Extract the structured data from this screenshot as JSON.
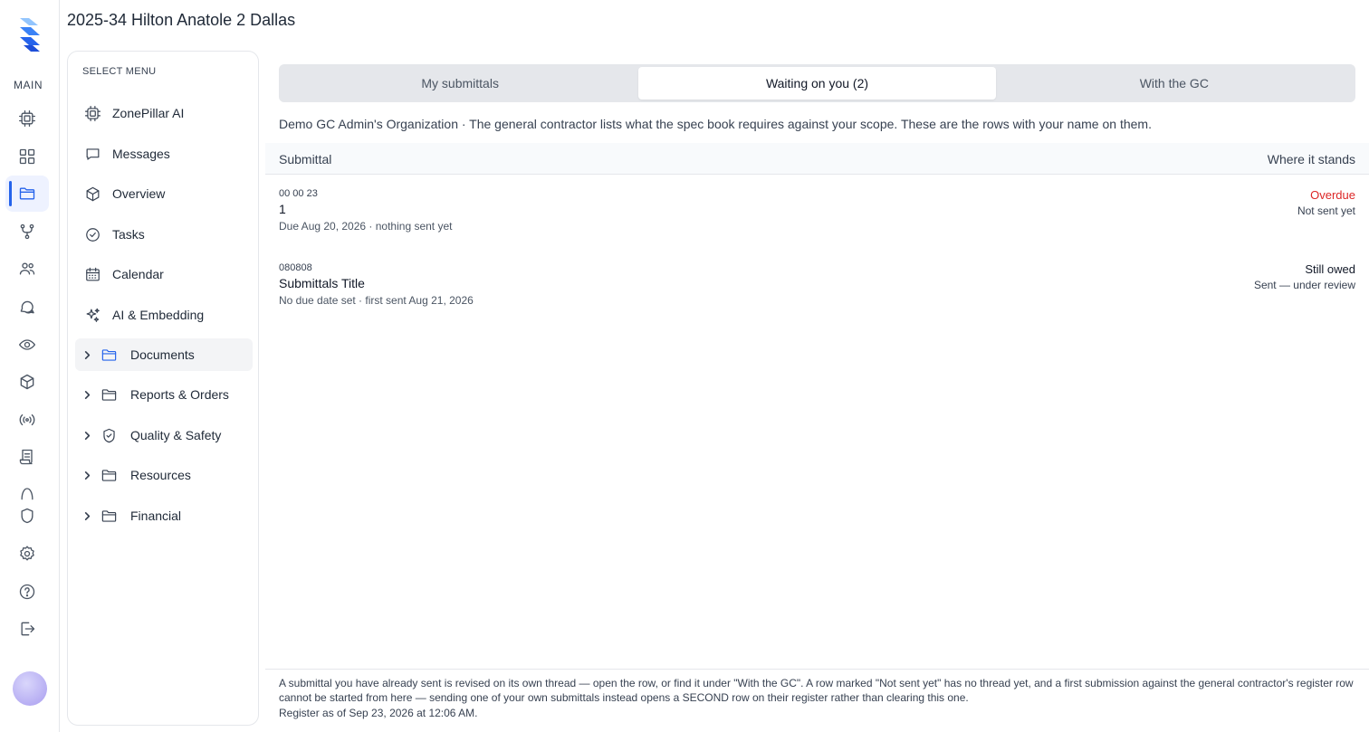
{
  "project": {
    "title": "2025-34 Hilton Anatole 2 Dallas"
  },
  "rail": {
    "section_label": "MAIN",
    "icons": [
      "chip-icon",
      "grid-icon",
      "folder-icon",
      "branch-icon",
      "users-icon",
      "chat-icon",
      "eye-icon",
      "cube-icon",
      "broadcast-icon",
      "receipt-icon",
      "arch-icon",
      "shield-icon",
      "gear-icon",
      "help-icon",
      "logout-icon"
    ],
    "active": "folder-icon",
    "accent": "#2563eb"
  },
  "menu": {
    "heading": "SELECT MENU",
    "items": [
      {
        "label": "ZonePillar AI",
        "icon": "chip-icon"
      },
      {
        "label": "Messages",
        "icon": "message-icon"
      },
      {
        "label": "Overview",
        "icon": "cube-icon"
      },
      {
        "label": "Tasks",
        "icon": "check-circle-icon"
      },
      {
        "label": "Calendar",
        "icon": "calendar-icon"
      },
      {
        "label": "AI & Embedding",
        "icon": "sparkles-icon"
      }
    ],
    "folders": [
      {
        "label": "Documents",
        "icon": "folder-icon",
        "selected": true
      },
      {
        "label": "Reports & Orders",
        "icon": "folder-icon"
      },
      {
        "label": "Quality & Safety",
        "icon": "shield-check-icon"
      },
      {
        "label": "Resources",
        "icon": "folder-icon"
      },
      {
        "label": "Financial",
        "icon": "folder-icon"
      }
    ]
  },
  "tabs": [
    {
      "label": "My submittals"
    },
    {
      "label": "Waiting on you (2)",
      "active": true
    },
    {
      "label": "With the GC"
    }
  ],
  "intro": "Demo GC Admin's Organization · The general contractor lists what the spec book requires against your scope. These are the rows with your name on them.",
  "table": {
    "col_submittal": "Submittal",
    "col_status": "Where it stands",
    "rows": [
      {
        "code": "00 00 23",
        "title": "1",
        "meta": "Due Aug 20, 2026 · nothing sent yet",
        "status": "Overdue",
        "status_color": "#dc2626",
        "substatus": "Not sent yet"
      },
      {
        "code": "080808",
        "title": "Submittals Title",
        "meta": "No due date set · first sent Aug 21, 2026",
        "status": "Still owed",
        "status_color": "#111827",
        "substatus": "Sent — under review"
      }
    ]
  },
  "footer": {
    "note": "A submittal you have already sent is revised on its own thread — open the row, or find it under \"With the GC\". A row marked \"Not sent yet\" has no thread yet, and a first submission against the general contractor's register row cannot be started from here — sending one of your own submittals instead opens a SECOND row on their register rather than clearing this one.",
    "as_of": "Register as of Sep 23, 2026 at 12:06 AM."
  }
}
